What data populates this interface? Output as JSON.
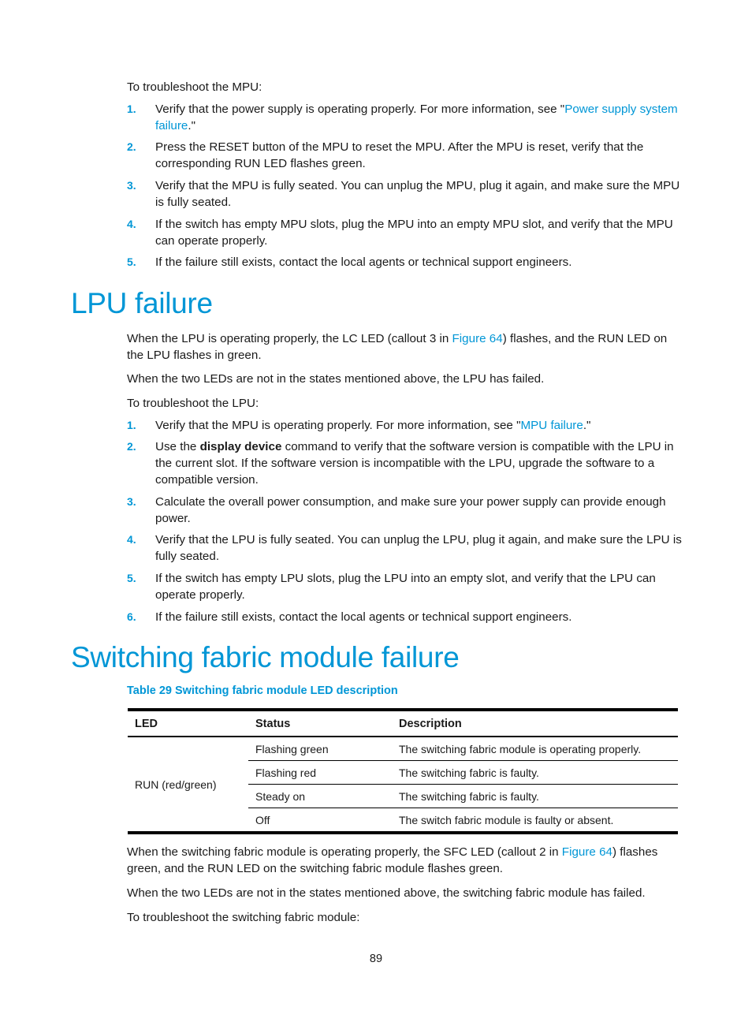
{
  "mpu_section": {
    "intro": "To troubleshoot the MPU:",
    "steps": [
      {
        "num": "1.",
        "before": "Verify that the power supply is operating properly. For more information, see \"",
        "link": "Power supply system failure",
        "after": ".\""
      },
      {
        "num": "2.",
        "text": "Press the RESET button of the MPU to reset the MPU. After the MPU is reset, verify that the corresponding RUN LED flashes green."
      },
      {
        "num": "3.",
        "text": "Verify that the MPU is fully seated. You can unplug the MPU, plug it again, and make sure the MPU is fully seated."
      },
      {
        "num": "4.",
        "text": "If the switch has empty MPU slots, plug the MPU into an empty MPU slot, and verify that the MPU can operate properly."
      },
      {
        "num": "5.",
        "text": "If the failure still exists, contact the local agents or technical support engineers."
      }
    ]
  },
  "lpu_section": {
    "heading": "LPU failure",
    "para1_before": "When the LPU is operating properly, the LC LED (callout 3 in ",
    "para1_link": "Figure 64",
    "para1_after": ") flashes, and the RUN LED on the LPU flashes in green.",
    "para2": "When the two LEDs are not in the states mentioned above, the LPU has failed.",
    "intro": "To troubleshoot the LPU:",
    "steps": [
      {
        "num": "1.",
        "before": "Verify that the MPU is operating properly. For more information, see \"",
        "link": "MPU failure",
        "after": ".\""
      },
      {
        "num": "2.",
        "before": "Use the ",
        "bold": "display device",
        "after": " command to verify that the software version is compatible with the LPU in the current slot. If the software version is incompatible with the LPU, upgrade the software to a compatible version."
      },
      {
        "num": "3.",
        "text": "Calculate the overall power consumption, and make sure your power supply can provide enough power."
      },
      {
        "num": "4.",
        "text": "Verify that the LPU is fully seated. You can unplug the LPU, plug it again, and make sure the LPU is fully seated."
      },
      {
        "num": "5.",
        "text": "If the switch has empty LPU slots, plug the LPU into an empty slot, and verify that the LPU can operate properly."
      },
      {
        "num": "6.",
        "text": "If the failure still exists, contact the local agents or technical support engineers."
      }
    ]
  },
  "sfm_section": {
    "heading": "Switching fabric module failure",
    "table_caption": "Table 29 Switching fabric module LED description",
    "table": {
      "headers": [
        "LED",
        "Status",
        "Description"
      ],
      "led": "RUN (red/green)",
      "rows": [
        {
          "status": "Flashing green",
          "description": "The switching fabric module is operating properly."
        },
        {
          "status": "Flashing red",
          "description": "The switching fabric is faulty."
        },
        {
          "status": "Steady on",
          "description": "The switching fabric is faulty."
        },
        {
          "status": "Off",
          "description": "The switch fabric module is faulty or absent."
        }
      ]
    },
    "para1_before": "When the switching fabric module is operating properly, the SFC LED (callout 2 in ",
    "para1_link": "Figure 64",
    "para1_after": ") flashes green, and the RUN LED on the switching fabric module flashes green.",
    "para2": "When the two LEDs are not in the states mentioned above, the switching fabric module has failed.",
    "intro": "To troubleshoot the switching fabric module:"
  },
  "page_number": "89",
  "colors": {
    "accent": "#0096d6",
    "text": "#1a1a1a"
  }
}
